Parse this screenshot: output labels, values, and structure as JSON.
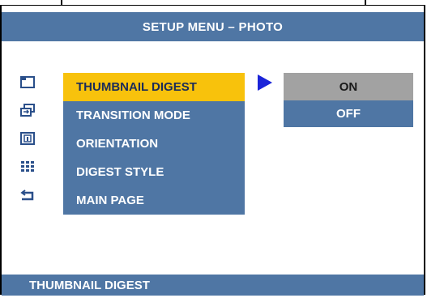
{
  "title": "SETUP MENU – PHOTO",
  "menu": {
    "items": [
      {
        "label": "THUMBNAIL DIGEST",
        "icon": "thumbnail-digest-icon",
        "selected": true
      },
      {
        "label": "TRANSITION MODE",
        "icon": "transition-mode-icon",
        "selected": false
      },
      {
        "label": "ORIENTATION",
        "icon": "orientation-icon",
        "selected": false
      },
      {
        "label": "DIGEST STYLE",
        "icon": "digest-style-icon",
        "selected": false
      },
      {
        "label": "MAIN PAGE",
        "icon": "main-page-return-icon",
        "selected": false
      }
    ]
  },
  "submenu": {
    "options": [
      {
        "label": "ON",
        "active": true
      },
      {
        "label": "OFF",
        "active": false
      }
    ]
  },
  "status": "THUMBNAIL DIGEST",
  "colors": {
    "bar": "#4f76a4",
    "highlight": "#f8c20c",
    "pointer": "#1b24d8",
    "active_option": "#a2a2a2"
  }
}
